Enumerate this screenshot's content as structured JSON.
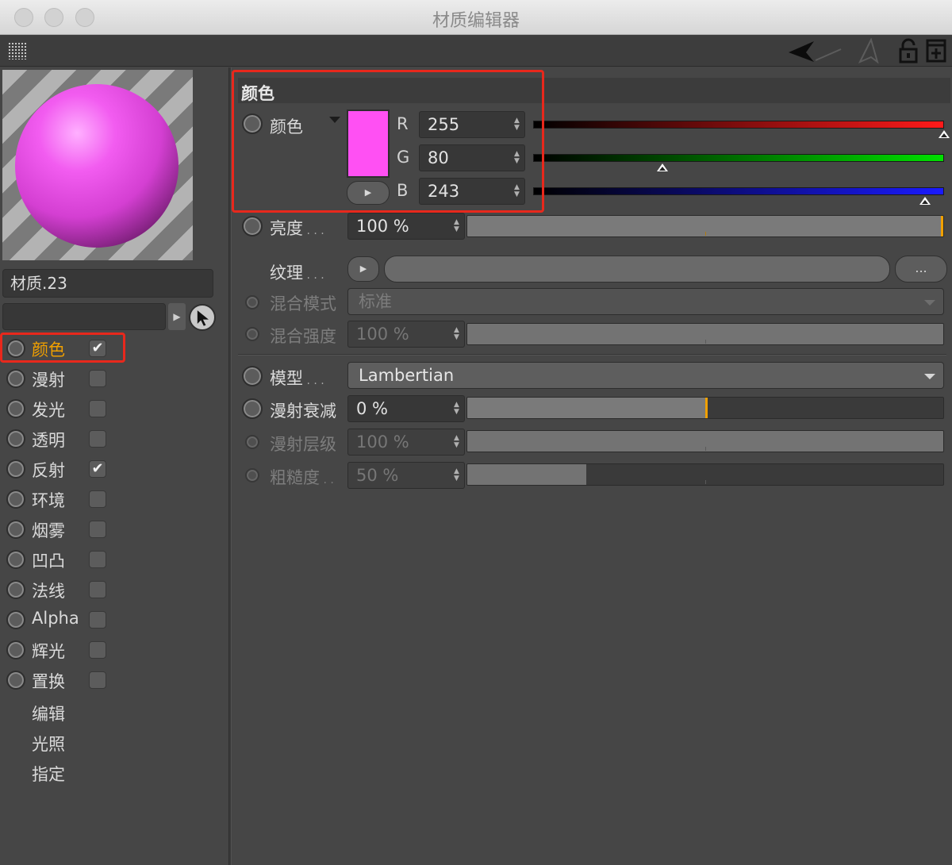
{
  "window": {
    "title": "材质编辑器"
  },
  "material": {
    "name": "材质.23",
    "search_value": ""
  },
  "channels": [
    {
      "label": "颜色",
      "checked": true,
      "active": true,
      "checkbox": true
    },
    {
      "label": "漫射",
      "checked": false,
      "active": false,
      "checkbox": true
    },
    {
      "label": "发光",
      "checked": false,
      "active": false,
      "checkbox": true
    },
    {
      "label": "透明",
      "checked": false,
      "active": false,
      "checkbox": true
    },
    {
      "label": "反射",
      "checked": true,
      "active": false,
      "checkbox": true
    },
    {
      "label": "环境",
      "checked": false,
      "active": false,
      "checkbox": true
    },
    {
      "label": "烟雾",
      "checked": false,
      "active": false,
      "checkbox": true
    },
    {
      "label": "凹凸",
      "checked": false,
      "active": false,
      "checkbox": true
    },
    {
      "label": "法线",
      "checked": false,
      "active": false,
      "checkbox": true
    },
    {
      "label": "Alpha",
      "checked": false,
      "active": false,
      "checkbox": true
    },
    {
      "label": "辉光",
      "checked": false,
      "active": false,
      "checkbox": true
    },
    {
      "label": "置换",
      "checked": false,
      "active": false,
      "checkbox": true
    }
  ],
  "extra_items": [
    "编辑",
    "光照",
    "指定"
  ],
  "color_section": {
    "title": "颜色",
    "color_label": "颜色",
    "swatch_hex": "#ff50f3",
    "components": [
      {
        "label": "R",
        "value": "255",
        "fraction": 1.0
      },
      {
        "label": "G",
        "value": "80",
        "fraction": 0.314
      },
      {
        "label": "B",
        "value": "243",
        "fraction": 0.953
      }
    ]
  },
  "brightness": {
    "label": "亮度",
    "dots": " . . .",
    "value": "100 %",
    "fraction": 1.0
  },
  "texture": {
    "label": "纹理",
    "dots": " . . .",
    "browse_label": "..."
  },
  "blend_mode": {
    "label": "混合模式",
    "value": "标准"
  },
  "blend_strength": {
    "label": "混合强度",
    "value": "100 %",
    "fraction": 1.0
  },
  "model": {
    "label": "模型",
    "dots": " . . .",
    "value": "Lambertian"
  },
  "diffuse_falloff": {
    "label": "漫射衰减",
    "value": "0 %",
    "fraction": 0.5
  },
  "diffuse_level": {
    "label": "漫射层级",
    "value": "100 %",
    "fraction": 1.0
  },
  "roughness": {
    "label": "粗糙度",
    "dots": " . .",
    "value": "50 %",
    "fraction": 0.25
  },
  "colors": {
    "accent": "#f0a000",
    "highlight": "#e8281c"
  }
}
